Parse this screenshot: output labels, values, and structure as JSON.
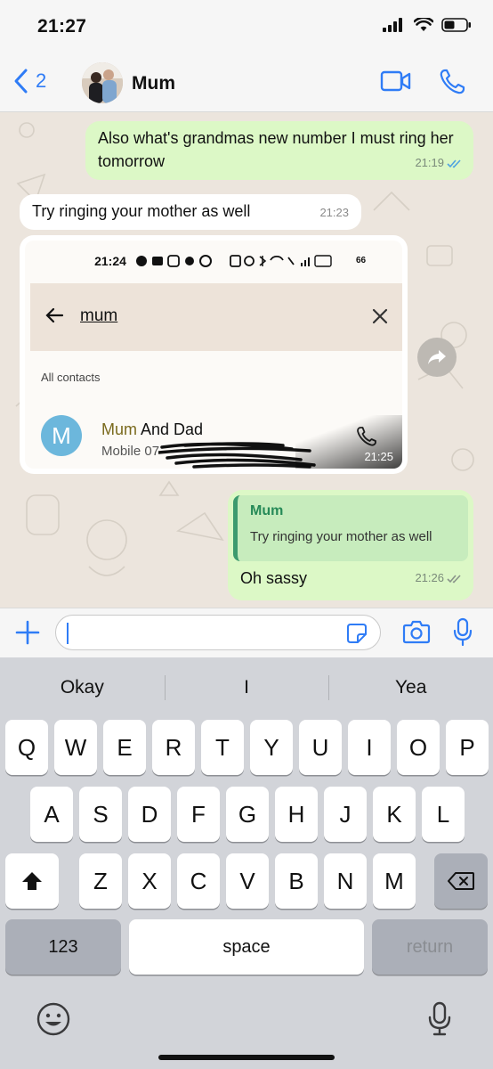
{
  "status_bar": {
    "time": "21:27",
    "signal_icon": "cellular-signal-icon",
    "wifi_icon": "wifi-icon",
    "battery_icon": "battery-icon"
  },
  "header": {
    "back_count": "2",
    "contact_name": "Mum",
    "back_icon": "chevron-left-icon",
    "video_icon": "video-camera-icon",
    "call_icon": "phone-icon",
    "accent_color": "#2f7cf6"
  },
  "messages": [
    {
      "direction": "outgoing",
      "text": "Also what's grandmas new number I must ring her tomorrow",
      "time": "21:19",
      "status": "read"
    },
    {
      "direction": "incoming",
      "text": "Try ringing your mother as well",
      "time": "21:23"
    },
    {
      "direction": "incoming",
      "type": "image",
      "time": "21:25",
      "screenshot": {
        "status_time": "21:24",
        "battery": "66",
        "search_query": "mum",
        "section_label": "All contacts",
        "avatar_letter": "M",
        "contact_name_match": "Mum",
        "contact_name_rest": " And Dad",
        "contact_sub": "Mobile 07"
      }
    },
    {
      "direction": "outgoing",
      "reply_to_author": "Mum",
      "reply_to_text": "Try ringing your mother as well",
      "text": "Oh sassy",
      "time": "21:26",
      "status": "delivered"
    }
  ],
  "input": {
    "value": "",
    "plus_icon": "plus-icon",
    "sticker_icon": "sticker-icon",
    "camera_icon": "camera-icon",
    "mic_icon": "microphone-icon"
  },
  "keyboard": {
    "suggestions": [
      "Okay",
      "I",
      "Yea"
    ],
    "row1": [
      "Q",
      "W",
      "E",
      "R",
      "T",
      "Y",
      "U",
      "I",
      "O",
      "P"
    ],
    "row2": [
      "A",
      "S",
      "D",
      "F",
      "G",
      "H",
      "J",
      "K",
      "L"
    ],
    "row3": [
      "Z",
      "X",
      "C",
      "V",
      "B",
      "N",
      "M"
    ],
    "numbers_label": "123",
    "space_label": "space",
    "return_label": "return"
  },
  "colors": {
    "outgoing_bubble": "#dcf8c6",
    "incoming_bubble": "#ffffff",
    "chat_background": "#ece5dd",
    "read_ticks": "#4fa3e0"
  }
}
